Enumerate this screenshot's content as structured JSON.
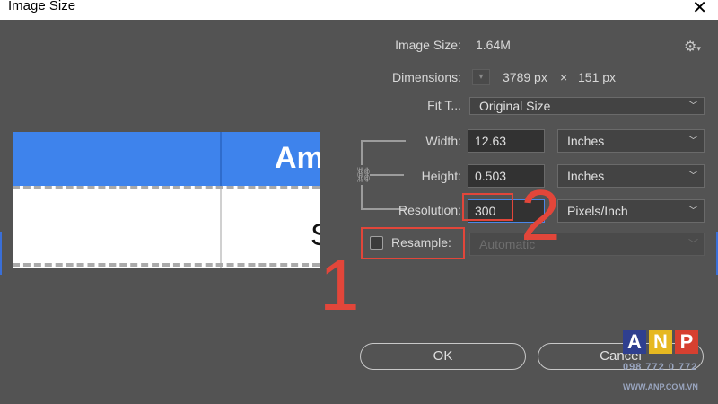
{
  "window": {
    "title": "Image Size",
    "close_label": "✕"
  },
  "info": {
    "image_size_label": "Image Size:",
    "image_size_value": "1.64M",
    "dimensions_label": "Dimensions:",
    "dim_width": "3789 px",
    "dim_x": "×",
    "dim_height": "151 px"
  },
  "fit_to": {
    "label": "Fit T...",
    "value": "Original Size"
  },
  "fields": {
    "width_label": "Width:",
    "width_value": "12.63",
    "width_unit": "Inches",
    "height_label": "Height:",
    "height_value": "0.503",
    "height_unit": "Inches",
    "resolution_label": "Resolution:",
    "resolution_value": "300",
    "resolution_unit": "Pixels/Inch"
  },
  "resample": {
    "label": "Resample:",
    "checked": false,
    "method": "Automatic"
  },
  "buttons": {
    "ok": "OK",
    "cancel": "Cancel"
  },
  "preview": {
    "text_top": "Am",
    "text_bottom": "S"
  },
  "annotations": {
    "one": "1",
    "two": "2"
  },
  "watermark": {
    "a": "A",
    "n": "N",
    "p": "P",
    "phone": "098 772 0 772",
    "site": "WWW.ANP.COM.VN"
  },
  "colors": {
    "accent_blue": "#3e83ec",
    "annotation_red": "#e2463a"
  },
  "icons": {
    "settings": "gear-icon",
    "link": "link-icon",
    "chevron": "chevron-down-icon"
  }
}
